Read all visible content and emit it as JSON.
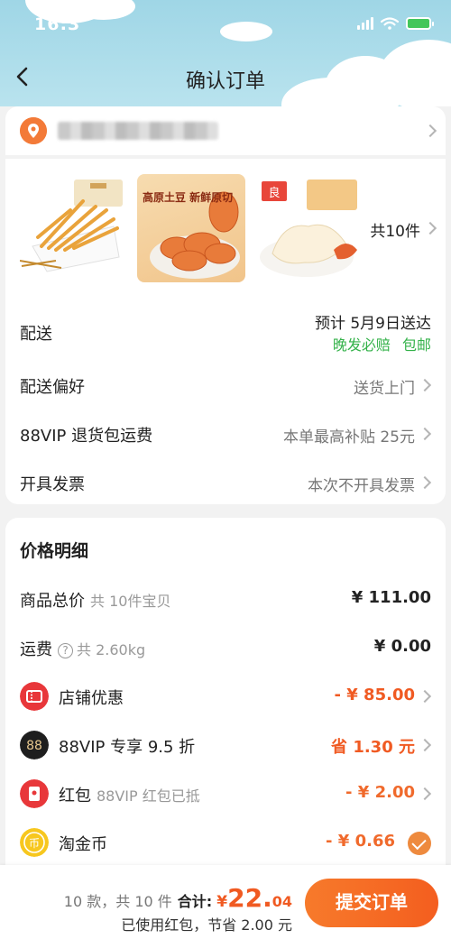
{
  "status_bar": {
    "time": "16:3"
  },
  "header": {
    "title": "确认订单"
  },
  "order": {
    "item_count_label": "共10件",
    "thumbnails": [
      {
        "name": "fries-snack"
      },
      {
        "name": "potato-chips",
        "text": "高原土豆 新鲜原切"
      },
      {
        "name": "shrimp-crackers",
        "brand": "良品铺子"
      }
    ],
    "delivery": {
      "label": "配送",
      "estimate": "预计 5月9日送达",
      "tag_late": "晚发必赔",
      "tag_free": "包邮"
    },
    "preference": {
      "label": "配送偏好",
      "value": "送货上门"
    },
    "vip_return": {
      "label": "88VIP 退货包运费",
      "value": "本单最高补贴 25元"
    },
    "invoice": {
      "label": "开具发票",
      "value": "本次不开具发票"
    }
  },
  "price_detail": {
    "title": "价格明细",
    "goods_total": {
      "label": "商品总价",
      "sub": "共 10件宝贝",
      "amount": "¥ 111.00"
    },
    "shipping": {
      "label": "运费",
      "sub": "共 2.60kg",
      "amount": "¥ 0.00"
    },
    "shop_discount": {
      "label": "店铺优惠",
      "amount": "- ¥ 85.00"
    },
    "vip_discount": {
      "label": "88VIP 专享 9.5 折",
      "amount": "省 1.30 元"
    },
    "red_packet": {
      "label": "红包",
      "sub": "88VIP 红包已抵",
      "amount": "- ¥ 2.00"
    },
    "taojinbi": {
      "label": "淘金币",
      "amount": "- ¥ 0.66",
      "checked": true
    }
  },
  "footer": {
    "count_text": "10 款，共 10 件",
    "total_label": "合计:",
    "currency": "¥",
    "total_integer": "22.",
    "total_decimal": "04",
    "saving_text": "已使用红包，节省 2.00 元",
    "submit_label": "提交订单"
  },
  "colors": {
    "accent": "#f05a22",
    "green": "#34b24a",
    "header_sky": "#9fd6e6"
  }
}
